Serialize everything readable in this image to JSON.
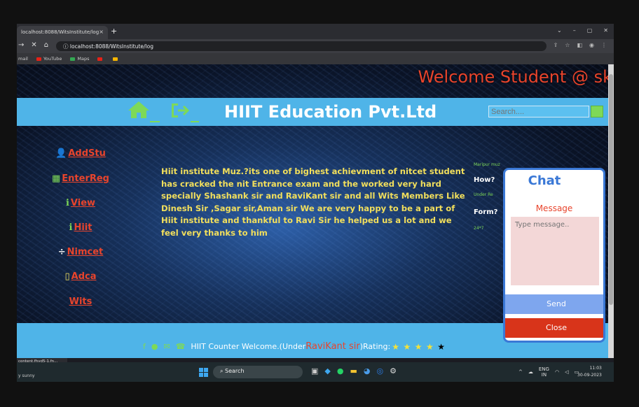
{
  "browser": {
    "tab_title": "localhost:8088/WitsInstitute/log",
    "tab_close": "×",
    "new_tab": "+",
    "url": "localhost:8088/WitsInstitute/log",
    "bookmarks": [
      "mail",
      "YouTube",
      "Maps"
    ]
  },
  "page": {
    "welcome": "Welcome Student @ sk",
    "title": "HIIT Education Pvt.Ltd",
    "search_placeholder": "Search....",
    "nav": [
      {
        "label": "AddStu",
        "icon": "add-user-icon"
      },
      {
        "label": "EnterReg",
        "icon": "register-icon"
      },
      {
        "label": "View",
        "icon": "info-icon"
      },
      {
        "label": "Hiit",
        "icon": "info-icon"
      },
      {
        "label": "Nimcet",
        "icon": "divide-icon"
      },
      {
        "label": "Adca",
        "icon": "box-icon"
      },
      {
        "label": "Wits",
        "icon": ""
      }
    ],
    "body_text": "Hiit institute Muz.?its one of bighest achievment of nitcet student has cracked the nit Entrance exam and the worked very hard specially Shashank sir and RaviKant sir and all Wits Members Like Dinesh Sir ,Sagar sir,Aman sir We are very happy to be a part of Hiit institute and thankful to Ravi Sir he helped us a lot and we feel very thanks to him",
    "right_col": {
      "small1": "Maripur muz",
      "how": "How?",
      "small2": "Under Re",
      "form": "Form?",
      "small3": "24*7"
    },
    "footer": {
      "text1": "HIIT Counter Welcome.(Under ",
      "name": "RaviKant sir",
      "text2": ")Rating:",
      "rating": 4,
      "max_rating": 5
    }
  },
  "chat": {
    "title": "Chat",
    "message_label": "Message",
    "message_placeholder": "Type message..",
    "send": "Send",
    "close": "Close"
  },
  "status_url": "content.fhyd5-1.fn...",
  "taskbar": {
    "weather": "y sunny",
    "search": "Search",
    "lang": "ENG",
    "region": "IN",
    "time": "11:03",
    "date": "30-09-2023"
  },
  "colors": {
    "accent_blue": "#4fb4e8",
    "title_red": "#e8442c",
    "body_yellow": "#f2df5c",
    "icon_green": "#7ed957"
  }
}
